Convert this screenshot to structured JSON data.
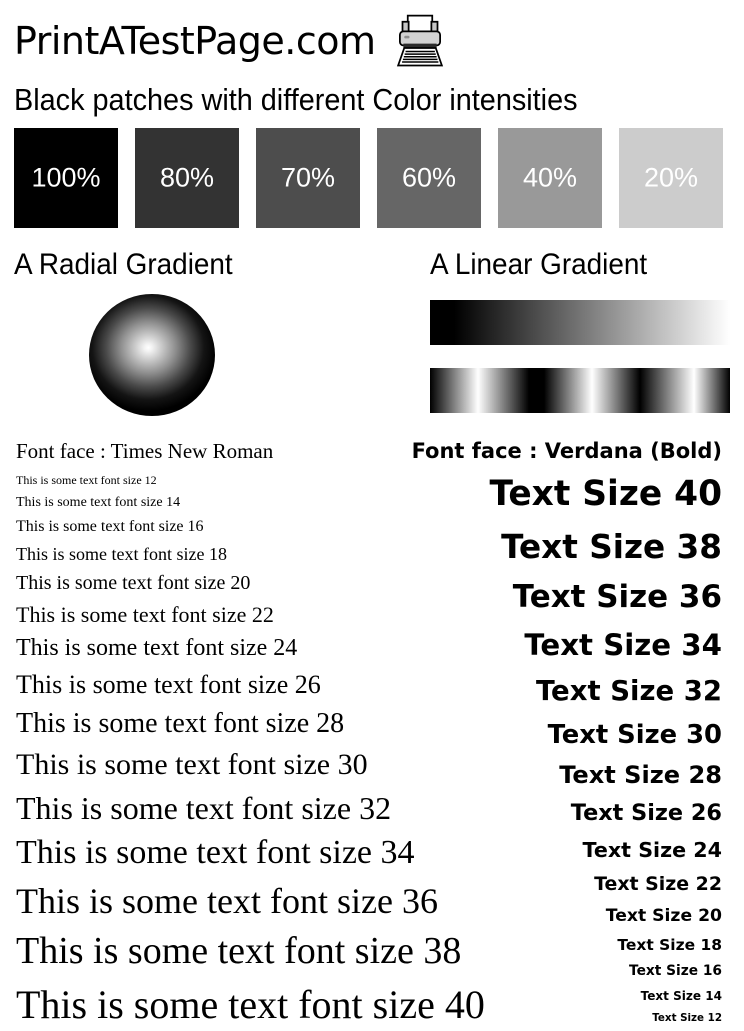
{
  "header": {
    "site_title": "PrintATestPage.com",
    "printer_icon": "printer-icon"
  },
  "patches_section": {
    "heading": "Black patches with different Color intensities",
    "patches": [
      {
        "label": "100%",
        "color": "#000000"
      },
      {
        "label": "80%",
        "color": "#333333"
      },
      {
        "label": "70%",
        "color": "#4d4d4d"
      },
      {
        "label": "60%",
        "color": "#666666"
      },
      {
        "label": "40%",
        "color": "#999999"
      },
      {
        "label": "20%",
        "color": "#cccccc"
      }
    ]
  },
  "gradients_section": {
    "radial_heading": "A Radial Gradient",
    "linear_heading": "A Linear Gradient"
  },
  "serif_column": {
    "heading": "Font face : Times New Roman",
    "lines": [
      {
        "text": "This is some text font size 12",
        "size": 12
      },
      {
        "text": "This is some text font size 14",
        "size": 14
      },
      {
        "text": "This is some text font size 16",
        "size": 16
      },
      {
        "text": "This is some text font size 18",
        "size": 18
      },
      {
        "text": "This is some text font size 20",
        "size": 20
      },
      {
        "text": "This is some text font size 22",
        "size": 22
      },
      {
        "text": "This is some text font size 24",
        "size": 24
      },
      {
        "text": "This is some text font size 26",
        "size": 26
      },
      {
        "text": "This is some text font size 28",
        "size": 28
      },
      {
        "text": "This is some text font size 30",
        "size": 30
      },
      {
        "text": "This is some text font size 32",
        "size": 32
      },
      {
        "text": "This is some text font size 34",
        "size": 34
      },
      {
        "text": "This is some text font size 36",
        "size": 36
      },
      {
        "text": "This is some text font size 38",
        "size": 38
      },
      {
        "text": "This is some text font size 40",
        "size": 40
      }
    ]
  },
  "sans_column": {
    "heading": "Font face : Verdana (Bold)",
    "lines": [
      {
        "text": "Text Size 40",
        "size": 40
      },
      {
        "text": "Text Size 38",
        "size": 38
      },
      {
        "text": "Text Size 36",
        "size": 36
      },
      {
        "text": "Text Size 34",
        "size": 34
      },
      {
        "text": "Text Size 32",
        "size": 32
      },
      {
        "text": "Text Size 30",
        "size": 30
      },
      {
        "text": "Text Size 28",
        "size": 28
      },
      {
        "text": "Text Size 26",
        "size": 26
      },
      {
        "text": "Text Size 24",
        "size": 24
      },
      {
        "text": "Text Size 22",
        "size": 22
      },
      {
        "text": "Text Size 20",
        "size": 20
      },
      {
        "text": "Text Size 18",
        "size": 18
      },
      {
        "text": "Text Size 16",
        "size": 16
      },
      {
        "text": "Text Size 14",
        "size": 14
      },
      {
        "text": "Text Size 12",
        "size": 12
      }
    ]
  }
}
